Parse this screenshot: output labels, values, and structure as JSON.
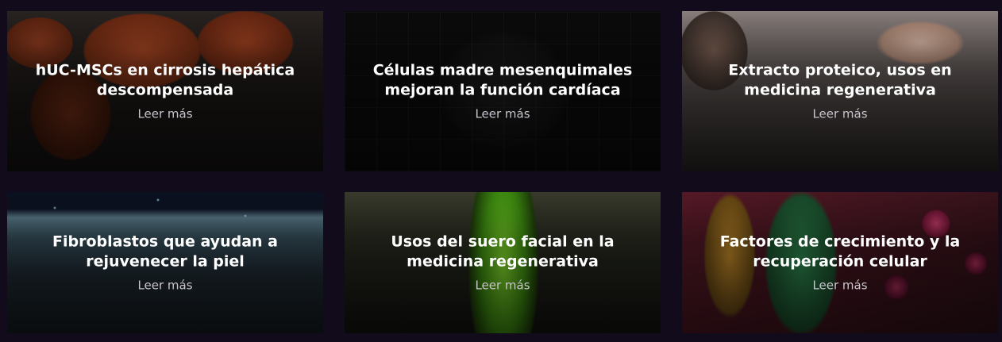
{
  "cards": [
    {
      "title": "hUC-MSCs en cirrosis hepática descompensada",
      "link": "Leer más"
    },
    {
      "title": "Células madre mesenquimales mejoran la función cardíaca",
      "link": "Leer más"
    },
    {
      "title": "Extracto proteico, usos en medicina regenerativa",
      "link": "Leer más"
    },
    {
      "title": "Fibroblastos que ayudan a rejuvenecer la piel",
      "link": "Leer más"
    },
    {
      "title": "Usos del suero facial en la medicina regenerativa",
      "link": "Leer más"
    },
    {
      "title": "Factores de crecimiento y la recuperación celular",
      "link": "Leer más"
    }
  ]
}
